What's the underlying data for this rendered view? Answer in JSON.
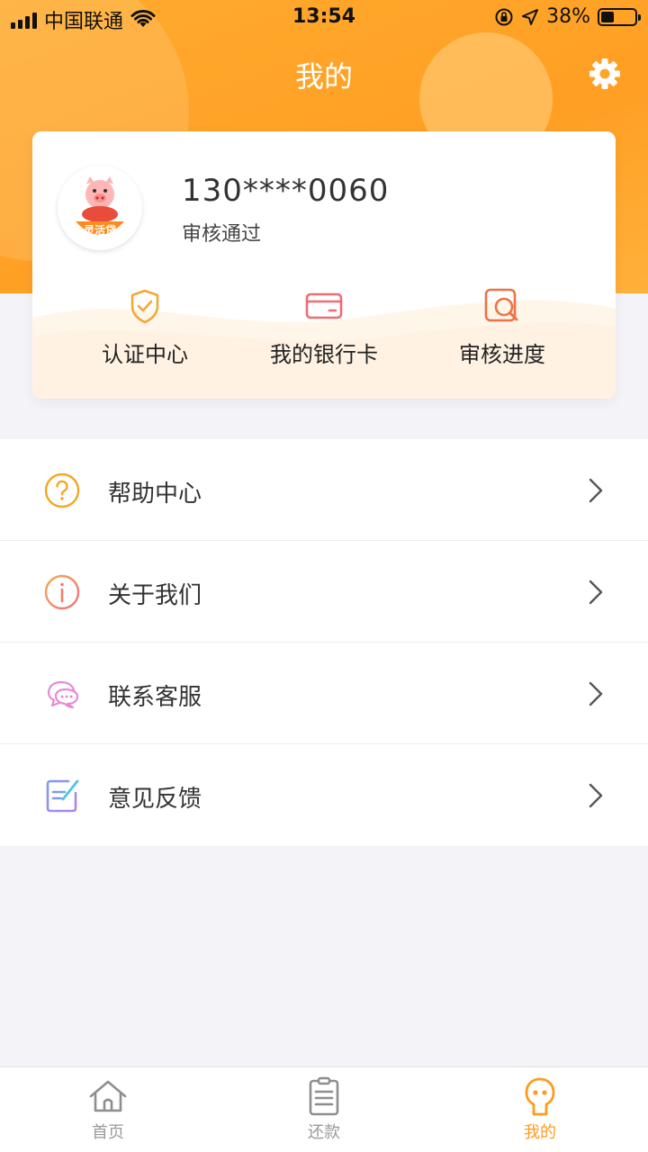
{
  "status_bar": {
    "carrier": "中国联通",
    "time": "13:54",
    "battery": "38%"
  },
  "header": {
    "title": "我的"
  },
  "user": {
    "phone": "130****0060",
    "status": "审核通过",
    "avatar_badge": "灵活贷"
  },
  "quick_actions": [
    {
      "label": "认证中心",
      "icon": "shield-check-icon"
    },
    {
      "label": "我的银行卡",
      "icon": "bank-card-icon"
    },
    {
      "label": "审核进度",
      "icon": "review-search-icon"
    }
  ],
  "menu": [
    {
      "label": "帮助中心",
      "icon": "help-icon"
    },
    {
      "label": "关于我们",
      "icon": "info-icon"
    },
    {
      "label": "联系客服",
      "icon": "chat-icon"
    },
    {
      "label": "意见反馈",
      "icon": "feedback-icon"
    }
  ],
  "tabs": [
    {
      "label": "首页",
      "icon": "home-icon",
      "active": false
    },
    {
      "label": "还款",
      "icon": "repayment-icon",
      "active": false
    },
    {
      "label": "我的",
      "icon": "profile-icon",
      "active": true
    }
  ],
  "colors": {
    "accent": "#ff9f24",
    "active_tab": "#ff9b1f",
    "inactive_tab": "#999999"
  }
}
